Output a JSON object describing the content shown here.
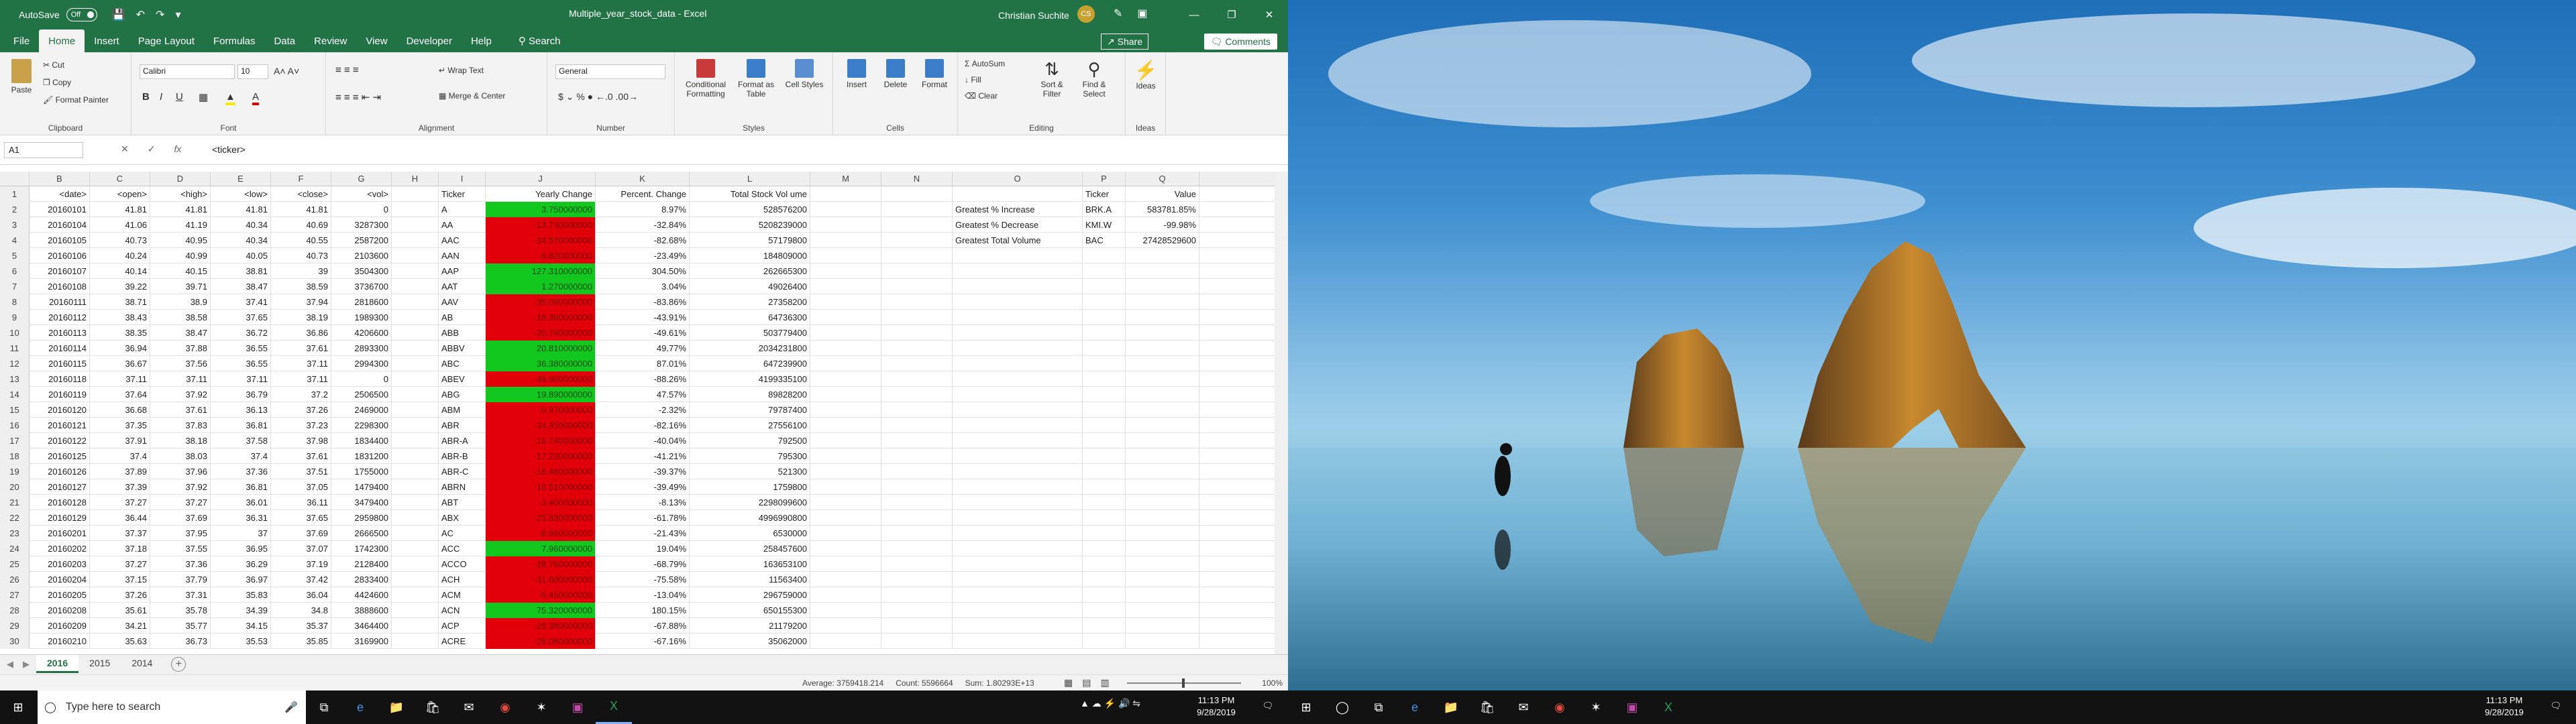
{
  "app": {
    "autosave_label": "AutoSave",
    "autosave_state": "Off",
    "title": "Multiple_year_stock_data  -  Excel",
    "user": "Christian Suchite",
    "user_initials": "CS"
  },
  "menu": {
    "tabs": [
      "File",
      "Home",
      "Insert",
      "Page Layout",
      "Formulas",
      "Data",
      "Review",
      "View",
      "Developer",
      "Help"
    ],
    "active": "Home",
    "search": "Search",
    "share": "Share",
    "comments": "Comments"
  },
  "ribbon": {
    "clipboard": {
      "paste": "Paste",
      "cut": "Cut",
      "copy": "Copy",
      "format_painter": "Format Painter",
      "label": "Clipboard"
    },
    "font": {
      "name": "Calibri",
      "size": "10",
      "label": "Font"
    },
    "alignment": {
      "wrap": "Wrap Text",
      "merge": "Merge & Center",
      "label": "Alignment"
    },
    "number": {
      "format": "General",
      "label": "Number"
    },
    "styles": {
      "conditional": "Conditional Formatting",
      "format_table": "Format as Table",
      "cell_styles": "Cell Styles",
      "label": "Styles"
    },
    "cells": {
      "insert": "Insert",
      "delete": "Delete",
      "format": "Format",
      "label": "Cells"
    },
    "editing": {
      "autosum": "AutoSum",
      "fill": "Fill",
      "clear": "Clear",
      "sort": "Sort & Filter",
      "find": "Find & Select",
      "label": "Editing"
    },
    "ideas": {
      "ideas": "Ideas",
      "label": "Ideas"
    }
  },
  "formula": {
    "cell": "A1",
    "value": "<ticker>"
  },
  "columns": [
    "B",
    "C",
    "D",
    "E",
    "F",
    "G",
    "H",
    "I",
    "J",
    "K",
    "L",
    "M",
    "N",
    "O",
    "P",
    "Q"
  ],
  "headers": {
    "B": "<date>",
    "C": "<open>",
    "D": "<high>",
    "E": "<low>",
    "F": "<close>",
    "G": "<vol>",
    "I": "Ticker",
    "J": "Yearly Change",
    "K": "Percent. Change",
    "L": "Total Stock Vol ume",
    "O": "",
    "P": "Ticker",
    "Q": "Value"
  },
  "rows": [
    {
      "n": "2",
      "B": "20160101",
      "C": "41.81",
      "D": "41.81",
      "E": "41.81",
      "F": "41.81",
      "G": "0",
      "I": "A",
      "J": "3.750000000",
      "K": "8.97%",
      "L": "528576200",
      "O": "Greatest % Increase",
      "P": "BRK.A",
      "Q": "583781.85%"
    },
    {
      "n": "3",
      "B": "20160104",
      "C": "41.06",
      "D": "41.19",
      "E": "40.34",
      "F": "40.69",
      "G": "3287300",
      "I": "AA",
      "J": "-13.730000000",
      "K": "-32.84%",
      "L": "5208239000",
      "O": "Greatest % Decrease",
      "P": "KMI.W",
      "Q": "-99.98%"
    },
    {
      "n": "4",
      "B": "20160105",
      "C": "40.73",
      "D": "40.95",
      "E": "40.34",
      "F": "40.55",
      "G": "2587200",
      "I": "AAC",
      "J": "-34.570000000",
      "K": "-82.68%",
      "L": "57179800",
      "O": "Greatest Total Volume",
      "P": "BAC",
      "Q": "27428529600"
    },
    {
      "n": "5",
      "B": "20160106",
      "C": "40.24",
      "D": "40.99",
      "E": "40.05",
      "F": "40.73",
      "G": "2103600",
      "I": "AAN",
      "J": "-9.820000000",
      "K": "-23.49%",
      "L": "184809000",
      "O": "",
      "P": "",
      "Q": ""
    },
    {
      "n": "6",
      "B": "20160107",
      "C": "40.14",
      "D": "40.15",
      "E": "38.81",
      "F": "39",
      "G": "3504300",
      "I": "AAP",
      "J": "127.310000000",
      "K": "304.50%",
      "L": "262665300",
      "O": "",
      "P": "",
      "Q": ""
    },
    {
      "n": "7",
      "B": "20160108",
      "C": "39.22",
      "D": "39.71",
      "E": "38.47",
      "F": "38.59",
      "G": "3736700",
      "I": "AAT",
      "J": "1.270000000",
      "K": "3.04%",
      "L": "49026400",
      "O": "",
      "P": "",
      "Q": ""
    },
    {
      "n": "8",
      "B": "20160111",
      "C": "38.71",
      "D": "38.9",
      "E": "37.41",
      "F": "37.94",
      "G": "2818600",
      "I": "AAV",
      "J": "-35.060000000",
      "K": "-83.86%",
      "L": "27358200",
      "O": "",
      "P": "",
      "Q": ""
    },
    {
      "n": "9",
      "B": "20160112",
      "C": "38.43",
      "D": "38.58",
      "E": "37.65",
      "F": "38.19",
      "G": "1989300",
      "I": "AB",
      "J": "-18.360000000",
      "K": "-43.91%",
      "L": "64736300",
      "O": "",
      "P": "",
      "Q": ""
    },
    {
      "n": "10",
      "B": "20160113",
      "C": "38.35",
      "D": "38.47",
      "E": "36.72",
      "F": "36.86",
      "G": "4206600",
      "I": "ABB",
      "J": "-20.740000000",
      "K": "-49.61%",
      "L": "503779400",
      "O": "",
      "P": "",
      "Q": ""
    },
    {
      "n": "11",
      "B": "20160114",
      "C": "36.94",
      "D": "37.88",
      "E": "36.55",
      "F": "37.61",
      "G": "2893300",
      "I": "ABBV",
      "J": "20.810000000",
      "K": "49.77%",
      "L": "2034231800",
      "O": "",
      "P": "",
      "Q": ""
    },
    {
      "n": "12",
      "B": "20160115",
      "C": "36.67",
      "D": "37.56",
      "E": "36.55",
      "F": "37.11",
      "G": "2994300",
      "I": "ABC",
      "J": "36.380000000",
      "K": "87.01%",
      "L": "647239900",
      "O": "",
      "P": "",
      "Q": ""
    },
    {
      "n": "13",
      "B": "20160118",
      "C": "37.11",
      "D": "37.11",
      "E": "37.11",
      "F": "37.11",
      "G": "0",
      "I": "ABEV",
      "J": "-36.900000000",
      "K": "-88.26%",
      "L": "4199335100",
      "O": "",
      "P": "",
      "Q": ""
    },
    {
      "n": "14",
      "B": "20160119",
      "C": "37.64",
      "D": "37.92",
      "E": "36.79",
      "F": "37.2",
      "G": "2506500",
      "I": "ABG",
      "J": "19.890000000",
      "K": "47.57%",
      "L": "89828200",
      "O": "",
      "P": "",
      "Q": ""
    },
    {
      "n": "15",
      "B": "20160120",
      "C": "36.68",
      "D": "37.61",
      "E": "36.13",
      "F": "37.26",
      "G": "2469000",
      "I": "ABM",
      "J": "-0.970000000",
      "K": "-2.32%",
      "L": "79787400",
      "O": "",
      "P": "",
      "Q": ""
    },
    {
      "n": "16",
      "B": "20160121",
      "C": "37.35",
      "D": "37.83",
      "E": "36.81",
      "F": "37.23",
      "G": "2298300",
      "I": "ABR",
      "J": "-34.350000000",
      "K": "-82.16%",
      "L": "27556100",
      "O": "",
      "P": "",
      "Q": ""
    },
    {
      "n": "17",
      "B": "20160122",
      "C": "37.91",
      "D": "38.18",
      "E": "37.58",
      "F": "37.98",
      "G": "1834400",
      "I": "ABR-A",
      "J": "-16.740000000",
      "K": "-40.04%",
      "L": "792500",
      "O": "",
      "P": "",
      "Q": ""
    },
    {
      "n": "18",
      "B": "20160125",
      "C": "37.4",
      "D": "38.03",
      "E": "37.4",
      "F": "37.61",
      "G": "1831200",
      "I": "ABR-B",
      "J": "-17.230000000",
      "K": "-41.21%",
      "L": "795300",
      "O": "",
      "P": "",
      "Q": ""
    },
    {
      "n": "19",
      "B": "20160126",
      "C": "37.89",
      "D": "37.96",
      "E": "37.36",
      "F": "37.51",
      "G": "1755000",
      "I": "ABR-C",
      "J": "-16.460000000",
      "K": "-39.37%",
      "L": "521300",
      "O": "",
      "P": "",
      "Q": ""
    },
    {
      "n": "20",
      "B": "20160127",
      "C": "37.39",
      "D": "37.92",
      "E": "36.81",
      "F": "37.05",
      "G": "1479400",
      "I": "ABRN",
      "J": "-16.510000000",
      "K": "-39.49%",
      "L": "1759800",
      "O": "",
      "P": "",
      "Q": ""
    },
    {
      "n": "21",
      "B": "20160128",
      "C": "37.27",
      "D": "37.27",
      "E": "36.01",
      "F": "36.11",
      "G": "3479400",
      "I": "ABT",
      "J": "-3.400000000",
      "K": "-8.13%",
      "L": "2298099600",
      "O": "",
      "P": "",
      "Q": ""
    },
    {
      "n": "22",
      "B": "20160129",
      "C": "36.44",
      "D": "37.69",
      "E": "36.31",
      "F": "37.65",
      "G": "2959800",
      "I": "ABX",
      "J": "-25.830000000",
      "K": "-61.78%",
      "L": "4996990800",
      "O": "",
      "P": "",
      "Q": ""
    },
    {
      "n": "23",
      "B": "20160201",
      "C": "37.37",
      "D": "37.95",
      "E": "37",
      "F": "37.69",
      "G": "2666500",
      "I": "AC",
      "J": "-8.960000000",
      "K": "-21.43%",
      "L": "6530000",
      "O": "",
      "P": "",
      "Q": ""
    },
    {
      "n": "24",
      "B": "20160202",
      "C": "37.18",
      "D": "37.55",
      "E": "36.95",
      "F": "37.07",
      "G": "1742300",
      "I": "ACC",
      "J": "7.960000000",
      "K": "19.04%",
      "L": "258457600",
      "O": "",
      "P": "",
      "Q": ""
    },
    {
      "n": "25",
      "B": "20160203",
      "C": "37.27",
      "D": "37.36",
      "E": "36.29",
      "F": "37.19",
      "G": "2128400",
      "I": "ACCO",
      "J": "-28.760000000",
      "K": "-68.79%",
      "L": "163653100",
      "O": "",
      "P": "",
      "Q": ""
    },
    {
      "n": "26",
      "B": "20160204",
      "C": "37.15",
      "D": "37.79",
      "E": "36.97",
      "F": "37.42",
      "G": "2833400",
      "I": "ACH",
      "J": "-31.600000000",
      "K": "-75.58%",
      "L": "11563400",
      "O": "",
      "P": "",
      "Q": ""
    },
    {
      "n": "27",
      "B": "20160205",
      "C": "37.26",
      "D": "37.31",
      "E": "35.83",
      "F": "36.04",
      "G": "4424600",
      "I": "ACM",
      "J": "-5.450000000",
      "K": "-13.04%",
      "L": "296759000",
      "O": "",
      "P": "",
      "Q": ""
    },
    {
      "n": "28",
      "B": "20160208",
      "C": "35.61",
      "D": "35.78",
      "E": "34.39",
      "F": "34.8",
      "G": "3888600",
      "I": "ACN",
      "J": "75.320000000",
      "K": "180.15%",
      "L": "650155300",
      "O": "",
      "P": "",
      "Q": ""
    },
    {
      "n": "29",
      "B": "20160209",
      "C": "34.21",
      "D": "35.77",
      "E": "34.15",
      "F": "35.37",
      "G": "3464400",
      "I": "ACP",
      "J": "-28.380000000",
      "K": "-67.88%",
      "L": "21179200",
      "O": "",
      "P": "",
      "Q": ""
    },
    {
      "n": "30",
      "B": "20160210",
      "C": "35.63",
      "D": "36.73",
      "E": "35.53",
      "F": "35.85",
      "G": "3169900",
      "I": "ACRE",
      "J": "-28.080000000",
      "K": "-67.16%",
      "L": "35062000",
      "O": "",
      "P": "",
      "Q": ""
    }
  ],
  "sheets": [
    "2016",
    "2015",
    "2014"
  ],
  "active_sheet": "2016",
  "status": {
    "average": "Average: 3759418.214",
    "count": "Count: 5596664",
    "sum": "Sum: 1.80293E+13",
    "zoom": "100%"
  },
  "taskbar": {
    "search": "Type here to search",
    "time_left": "11:13 PM",
    "date_left": "9/28/2019",
    "time_right": "11:13 PM",
    "date_right": "9/28/2019"
  },
  "colors": {
    "excel_green": "#217346",
    "cell_red": "#e1000a",
    "cell_green": "#12c81e"
  }
}
